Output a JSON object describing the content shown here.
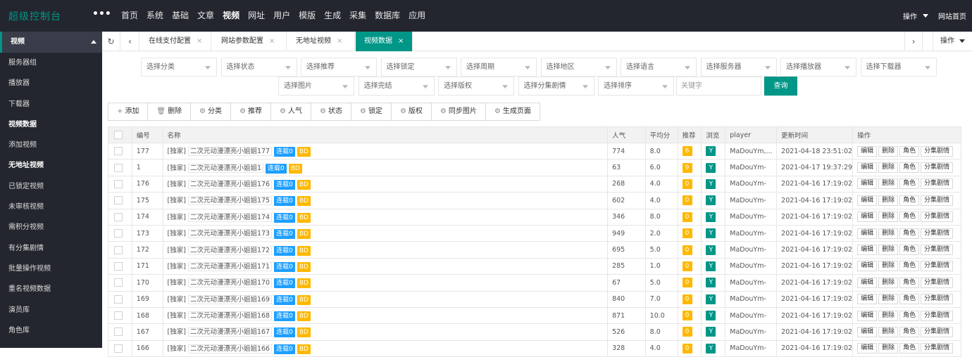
{
  "app": {
    "title": "超级控制台"
  },
  "topnav": {
    "more": "•••",
    "items": [
      "首页",
      "系统",
      "基础",
      "文章",
      "视频",
      "网址",
      "用户",
      "模版",
      "生成",
      "采集",
      "数据库",
      "应用"
    ],
    "active_index": 4,
    "right_action": "操作",
    "right_home": "网站首页"
  },
  "sidebar": {
    "header": "视频",
    "items": [
      {
        "label": "服务器组",
        "bold": false
      },
      {
        "label": "播放器",
        "bold": false
      },
      {
        "label": "下载器",
        "bold": false
      },
      {
        "label": "视频数据",
        "bold": true
      },
      {
        "label": "添加视频",
        "bold": false
      },
      {
        "label": "无地址视频",
        "bold": true
      },
      {
        "label": "已锁定视频",
        "bold": false
      },
      {
        "label": "未审核视频",
        "bold": false
      },
      {
        "label": "需积分视频",
        "bold": false
      },
      {
        "label": "有分集剧情",
        "bold": false
      },
      {
        "label": "批量操作视频",
        "bold": false
      },
      {
        "label": "重名视频数据",
        "bold": false
      },
      {
        "label": "演员库",
        "bold": false
      },
      {
        "label": "角色库",
        "bold": false
      }
    ]
  },
  "tabs": {
    "items": [
      "在线支付配置",
      "网站参数配置",
      "无地址视频",
      "视频数据"
    ],
    "active_index": 3,
    "close_glyph": "×",
    "right_action": "操作"
  },
  "filters": {
    "row1": [
      "选择分类",
      "选择状态",
      "选择推荐",
      "选择锁定",
      "选择周期",
      "选择地区",
      "选择语言",
      "选择服务器",
      "选择播放器",
      "选择下载器"
    ],
    "row2": [
      "选择图片",
      "选择完结",
      "选择版权",
      "选择分集剧情",
      "选择排序"
    ],
    "keyword_placeholder": "关键字",
    "query_label": "查询"
  },
  "toolbar": {
    "add": "添加",
    "delete": "删除",
    "category": "分类",
    "recommend": "推荐",
    "popularity": "人气",
    "status": "状态",
    "lock": "锁定",
    "copyright": "版权",
    "sync_images": "同步图片",
    "generate_pages": "生成页面"
  },
  "table": {
    "headers": {
      "id": "编号",
      "name": "名称",
      "hits": "人气",
      "score": "平均分",
      "level": "推荐",
      "browse": "浏览",
      "player": "player",
      "updated": "更新时间",
      "ops": "操作"
    },
    "ops_labels": [
      "编辑",
      "删除",
      "角色",
      "分集剧情"
    ],
    "name_prefix": "[独家]",
    "tag_serial": "连载0",
    "tag_bd": "BD",
    "rows": [
      {
        "id": "177",
        "title": "二次元动漫漂亮小姐姐177",
        "hits": "774",
        "score": "8.0",
        "level": "6",
        "browse": "Y",
        "player": "MaDouYm,...",
        "updated": "2021-04-18 23:51:02"
      },
      {
        "id": "1",
        "title": "二次元动漫漂亮小姐姐1",
        "hits": "63",
        "score": "6.0",
        "level": "9",
        "browse": "Y",
        "player": "MaDouYm-",
        "updated": "2021-04-17 19:37:29"
      },
      {
        "id": "176",
        "title": "二次元动漫漂亮小姐姐176",
        "hits": "268",
        "score": "4.0",
        "level": "0",
        "browse": "Y",
        "player": "MaDouYm-",
        "updated": "2021-04-16 17:19:02"
      },
      {
        "id": "175",
        "title": "二次元动漫漂亮小姐姐175",
        "hits": "602",
        "score": "4.0",
        "level": "0",
        "browse": "Y",
        "player": "MaDouYm-",
        "updated": "2021-04-16 17:19:02"
      },
      {
        "id": "174",
        "title": "二次元动漫漂亮小姐姐174",
        "hits": "346",
        "score": "8.0",
        "level": "0",
        "browse": "Y",
        "player": "MaDouYm-",
        "updated": "2021-04-16 17:19:02"
      },
      {
        "id": "173",
        "title": "二次元动漫漂亮小姐姐173",
        "hits": "949",
        "score": "2.0",
        "level": "0",
        "browse": "Y",
        "player": "MaDouYm-",
        "updated": "2021-04-16 17:19:02"
      },
      {
        "id": "172",
        "title": "二次元动漫漂亮小姐姐172",
        "hits": "695",
        "score": "5.0",
        "level": "0",
        "browse": "Y",
        "player": "MaDouYm-",
        "updated": "2021-04-16 17:19:02"
      },
      {
        "id": "171",
        "title": "二次元动漫漂亮小姐姐171",
        "hits": "285",
        "score": "1.0",
        "level": "0",
        "browse": "Y",
        "player": "MaDouYm-",
        "updated": "2021-04-16 17:19:02"
      },
      {
        "id": "170",
        "title": "二次元动漫漂亮小姐姐170",
        "hits": "67",
        "score": "5.0",
        "level": "0",
        "browse": "Y",
        "player": "MaDouYm-",
        "updated": "2021-04-16 17:19:02"
      },
      {
        "id": "169",
        "title": "二次元动漫漂亮小姐姐169",
        "hits": "840",
        "score": "7.0",
        "level": "0",
        "browse": "Y",
        "player": "MaDouYm-",
        "updated": "2021-04-16 17:19:02"
      },
      {
        "id": "168",
        "title": "二次元动漫漂亮小姐姐168",
        "hits": "871",
        "score": "10.0",
        "level": "0",
        "browse": "Y",
        "player": "MaDouYm-",
        "updated": "2021-04-16 17:19:02"
      },
      {
        "id": "167",
        "title": "二次元动漫漂亮小姐姐167",
        "hits": "526",
        "score": "8.0",
        "level": "0",
        "browse": "Y",
        "player": "MaDouYm-",
        "updated": "2021-04-16 17:19:02"
      },
      {
        "id": "166",
        "title": "二次元动漫漂亮小姐姐166",
        "hits": "328",
        "score": "4.0",
        "level": "0",
        "browse": "Y",
        "player": "MaDouYm-",
        "updated": "2021-04-16 17:19:02"
      }
    ]
  },
  "colors": {
    "accent": "#009688",
    "topbar": "#23262e",
    "blue_tag": "#1e9fff",
    "orange_tag": "#ffb800"
  }
}
